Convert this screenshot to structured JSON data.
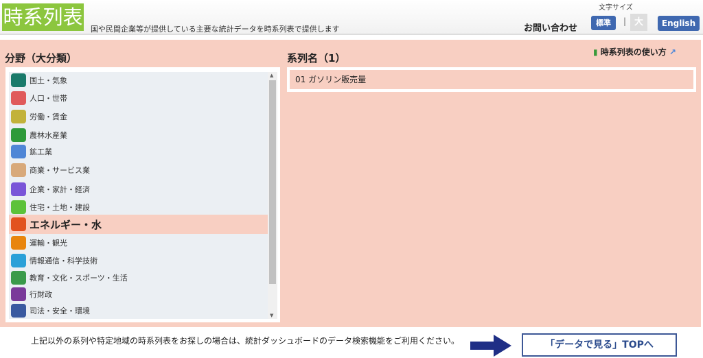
{
  "header": {
    "logo": "時系列表",
    "tagline": "国や民間企業等が提供している主要な統計データを時系列表で提供します",
    "font_size_label": "文字サイズ",
    "contact": "お問い合わせ",
    "size_standard": "標準",
    "size_separator": "|",
    "size_large": "大",
    "english": "English"
  },
  "left": {
    "title": "分野（大分類）",
    "items": [
      {
        "label": "国土・気象",
        "icon": "land-weather-icon",
        "color": "#1a7a6a"
      },
      {
        "label": "人口・世帯",
        "icon": "population-icon",
        "color": "#e05a5a"
      },
      {
        "label": "労働・賃金",
        "icon": "labor-icon",
        "color": "#c2b23a"
      },
      {
        "label": "農林水産業",
        "icon": "agriculture-fish-icon",
        "color": "#2e9a3a"
      },
      {
        "label": "鉱工業",
        "icon": "gears-icon",
        "color": "#4f86d6"
      },
      {
        "label": "商業・サービス業",
        "icon": "commerce-icon",
        "color": "#d8a97a"
      },
      {
        "label": "企業・家計・経済",
        "icon": "money-bag-icon",
        "color": "#7a55d8"
      },
      {
        "label": "住宅・土地・建設",
        "icon": "house-icon",
        "color": "#5cc23a"
      },
      {
        "label": "エネルギー・水",
        "icon": "bulb-drop-icon",
        "color": "#e2521e",
        "selected": true
      },
      {
        "label": "運輸・観光",
        "icon": "car-icon",
        "color": "#e8850e"
      },
      {
        "label": "情報通信・科学技術",
        "icon": "satellite-icon",
        "color": "#2aa0d8"
      },
      {
        "label": "教育・文化・スポーツ・生活",
        "icon": "education-icon",
        "color": "#3a9a4a"
      },
      {
        "label": "行財政",
        "icon": "finance-icon",
        "color": "#7a3a9a"
      },
      {
        "label": "司法・安全・環境",
        "icon": "court-icon",
        "color": "#3a5aa0"
      }
    ]
  },
  "right": {
    "title": "系列名（1）",
    "howto": "時系列表の使い方",
    "series": [
      "01 ガソリン販売量"
    ]
  },
  "footer": {
    "note": "上記以外の系列や特定地域の時系列表をお探しの場合は、統計ダッシュボードのデータ検索機能をご利用ください。",
    "top_button": "「データで見る」TOPへ"
  }
}
